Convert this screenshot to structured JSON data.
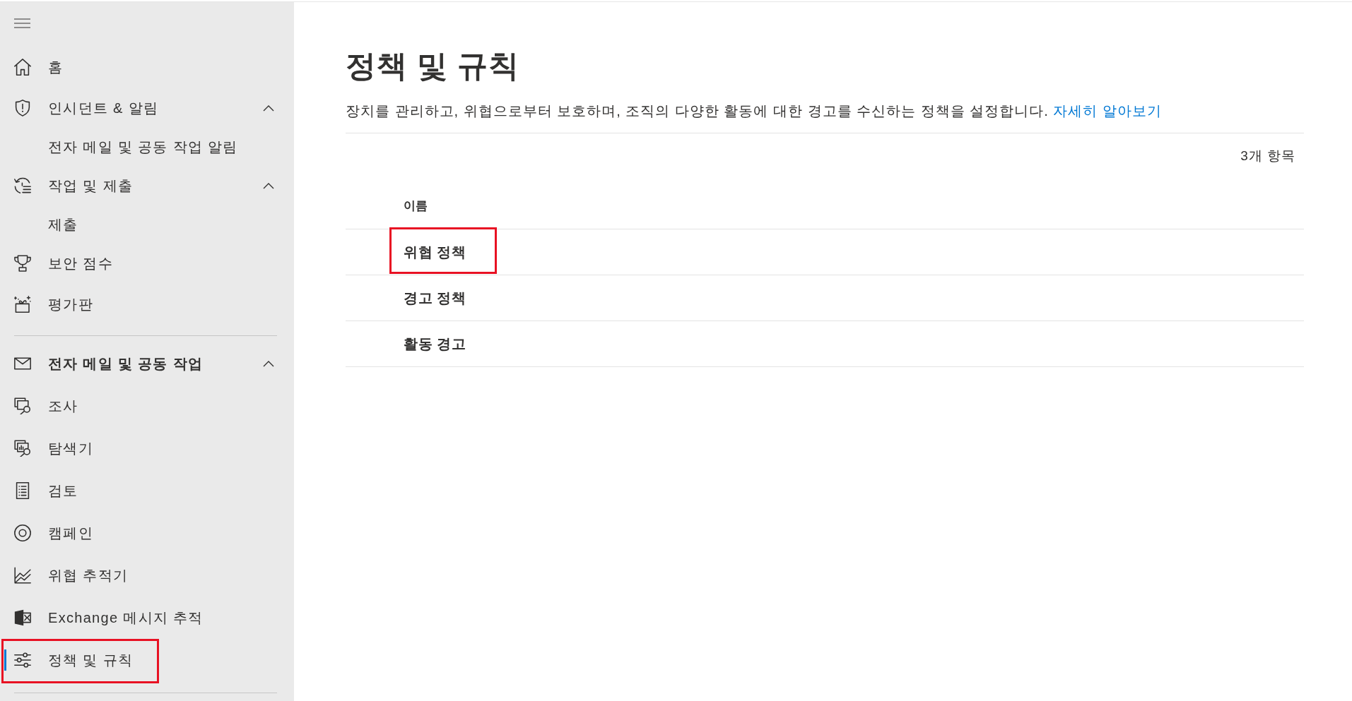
{
  "sidebar": {
    "sections": [
      {
        "items": [
          {
            "label": "홈",
            "selected": false,
            "highlighted": false
          },
          {
            "label": "인시던트 & 알림",
            "selected": false,
            "highlighted": false,
            "expanded": true,
            "children": [
              {
                "label": "전자 메일 및 공동 작업 알림",
                "selected": false,
                "highlighted": false
              }
            ]
          },
          {
            "label": "작업 및 제출",
            "selected": false,
            "highlighted": false,
            "expanded": true,
            "children": [
              {
                "label": "제출",
                "selected": false,
                "highlighted": false
              }
            ]
          },
          {
            "label": "보안 점수",
            "selected": false,
            "highlighted": false
          },
          {
            "label": "평가판",
            "selected": false,
            "highlighted": false
          }
        ]
      },
      {
        "heading": {
          "label": "전자 메일 및 공동 작업",
          "expanded": true
        },
        "items": [
          {
            "label": "조사",
            "selected": false,
            "highlighted": false
          },
          {
            "label": "탐색기",
            "selected": false,
            "highlighted": false
          },
          {
            "label": "검토",
            "selected": false,
            "highlighted": false
          },
          {
            "label": "캠페인",
            "selected": false,
            "highlighted": false
          },
          {
            "label": "위협 추적기",
            "selected": false,
            "highlighted": false
          },
          {
            "label": "Exchange 메시지 추적",
            "selected": false,
            "highlighted": false
          },
          {
            "label": "정책 및 규칙",
            "selected": true,
            "highlighted": true
          }
        ]
      }
    ]
  },
  "page": {
    "title": "정책 및 규칙",
    "description": "장치를 관리하고, 위협으로부터 보호하며, 조직의 다양한 활동에 대한 경고를 수신하는 정책을 설정합니다.",
    "link": "자세히 알아보기",
    "item_count": "3개 항목"
  },
  "table": {
    "columns": [
      "이름"
    ],
    "rows": [
      {
        "name": "위협 정책",
        "highlighted": true
      },
      {
        "name": "경고 정책",
        "highlighted": false
      },
      {
        "name": "활동 경고",
        "highlighted": false
      }
    ]
  }
}
